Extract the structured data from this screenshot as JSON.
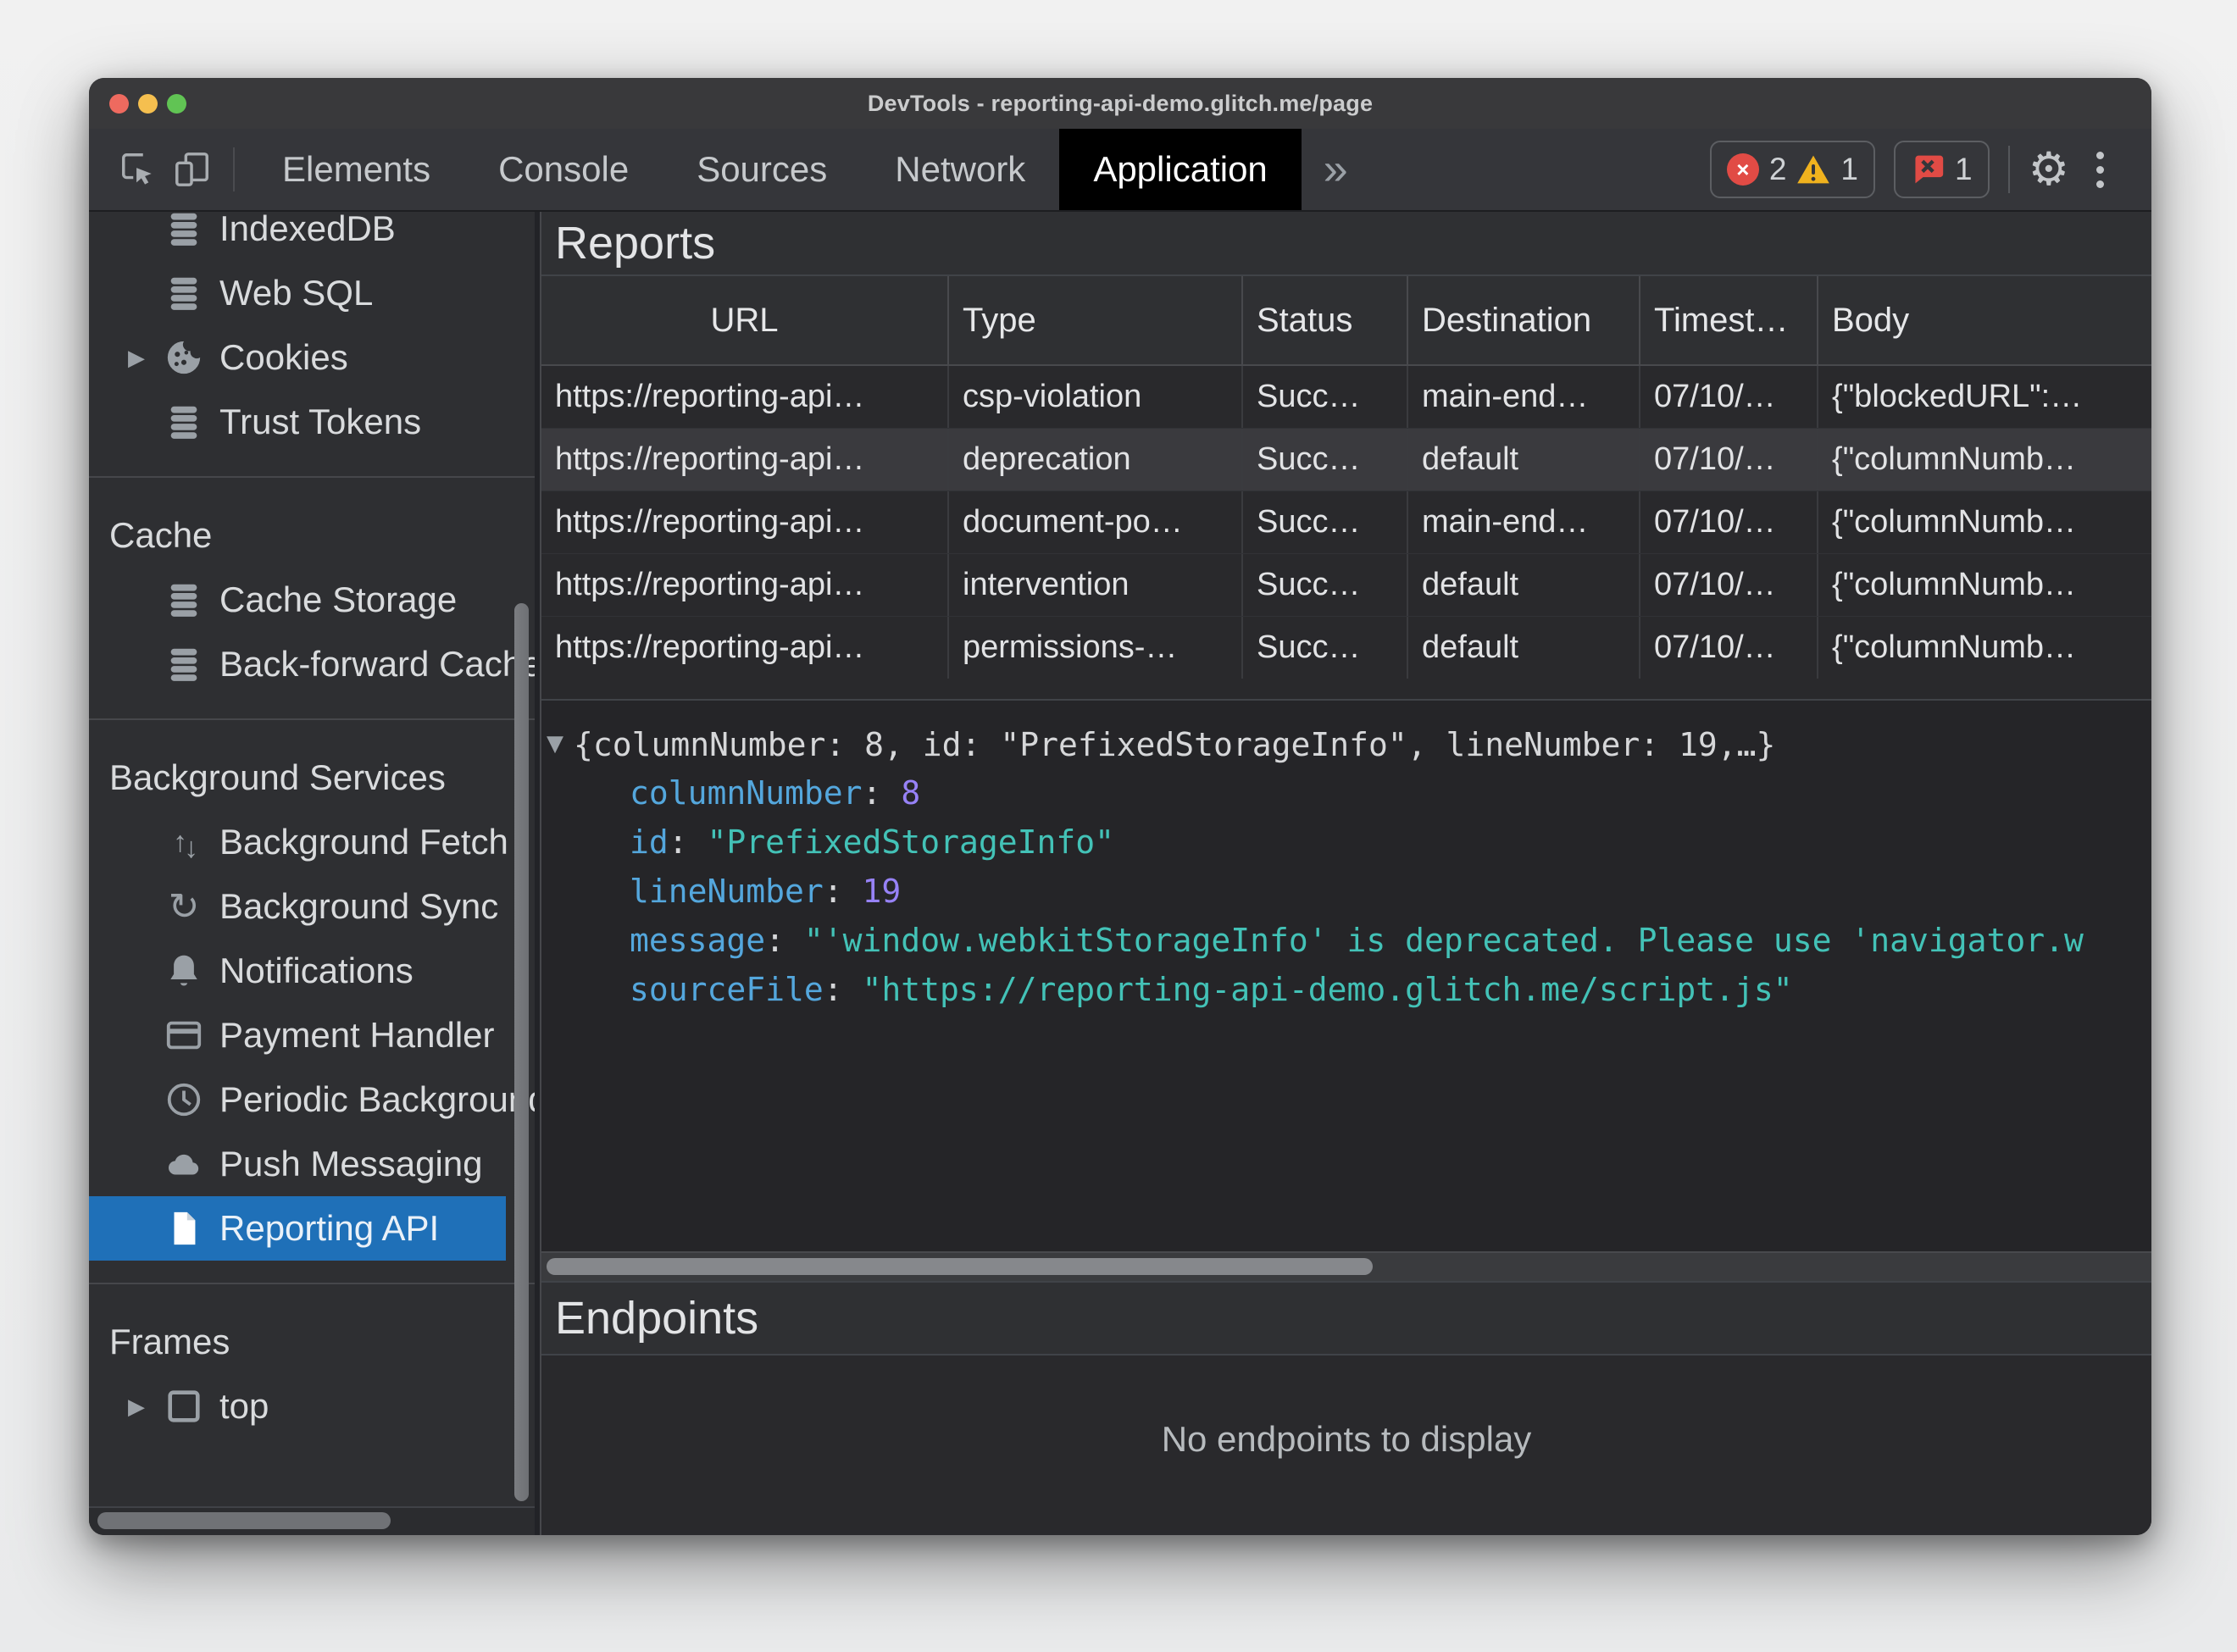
{
  "window": {
    "title": "DevTools - reporting-api-demo.glitch.me/page"
  },
  "toolbar": {
    "tabs": [
      {
        "label": "Elements"
      },
      {
        "label": "Console"
      },
      {
        "label": "Sources"
      },
      {
        "label": "Network"
      },
      {
        "label": "Application"
      }
    ],
    "active_tab": "Application",
    "overflow_glyph": "»",
    "error_count": "2",
    "warning_count": "1",
    "issues_count": "1"
  },
  "sidebar": {
    "items": [
      {
        "label": "IndexedDB"
      },
      {
        "label": "Web SQL"
      },
      {
        "label": "Cookies"
      },
      {
        "label": "Trust Tokens"
      },
      {
        "label": "Cache Storage"
      },
      {
        "label": "Back-forward Cache"
      },
      {
        "label": "Background Fetch"
      },
      {
        "label": "Background Sync"
      },
      {
        "label": "Notifications"
      },
      {
        "label": "Payment Handler"
      },
      {
        "label": "Periodic Background Sync"
      },
      {
        "label": "Push Messaging"
      },
      {
        "label": "Reporting API"
      },
      {
        "label": "top"
      }
    ],
    "headers": {
      "cache": "Cache",
      "background": "Background Services",
      "frames": "Frames"
    },
    "selected_item": "Reporting API"
  },
  "reports": {
    "title": "Reports",
    "columns": [
      "URL",
      "Type",
      "Status",
      "Destination",
      "Timest…",
      "Body"
    ],
    "rows": [
      {
        "url": "https://reporting-api…",
        "type": "csp-violation",
        "status": "Succ…",
        "destination": "main-end…",
        "timestamp": "07/10/…",
        "body": "{\"blockedURL\":…"
      },
      {
        "url": "https://reporting-api…",
        "type": "deprecation",
        "status": "Succ…",
        "destination": "default",
        "timestamp": "07/10/…",
        "body": "{\"columnNumb…"
      },
      {
        "url": "https://reporting-api…",
        "type": "document-po…",
        "status": "Succ…",
        "destination": "main-end…",
        "timestamp": "07/10/…",
        "body": "{\"columnNumb…"
      },
      {
        "url": "https://reporting-api…",
        "type": "intervention",
        "status": "Succ…",
        "destination": "default",
        "timestamp": "07/10/…",
        "body": "{\"columnNumb…"
      },
      {
        "url": "https://reporting-api…",
        "type": "permissions-…",
        "status": "Succ…",
        "destination": "default",
        "timestamp": "07/10/…",
        "body": "{\"columnNumb…"
      }
    ],
    "selected_row": "deprecation"
  },
  "report_detail": {
    "preview": "{columnNumber: 8, id: \"PrefixedStorageInfo\", lineNumber: 19,…}",
    "properties": [
      {
        "key": "columnNumber",
        "value": "8",
        "value_type": "number"
      },
      {
        "key": "id",
        "value": "\"PrefixedStorageInfo\"",
        "value_type": "string"
      },
      {
        "key": "lineNumber",
        "value": "19",
        "value_type": "number"
      },
      {
        "key": "message",
        "value": "\"'window.webkitStorageInfo' is deprecated. Please use 'navigator.w",
        "value_type": "string"
      },
      {
        "key": "sourceFile",
        "value": "\"https://reporting-api-demo.glitch.me/script.js\"",
        "value_type": "string"
      }
    ]
  },
  "endpoints": {
    "title": "Endpoints",
    "empty_message": "No endpoints to display"
  },
  "colors": {
    "selection_blue": "#1f70b8",
    "error_red": "#e14b45",
    "warning_yellow": "#f0b21e",
    "active_tab_bg": "#000000"
  }
}
